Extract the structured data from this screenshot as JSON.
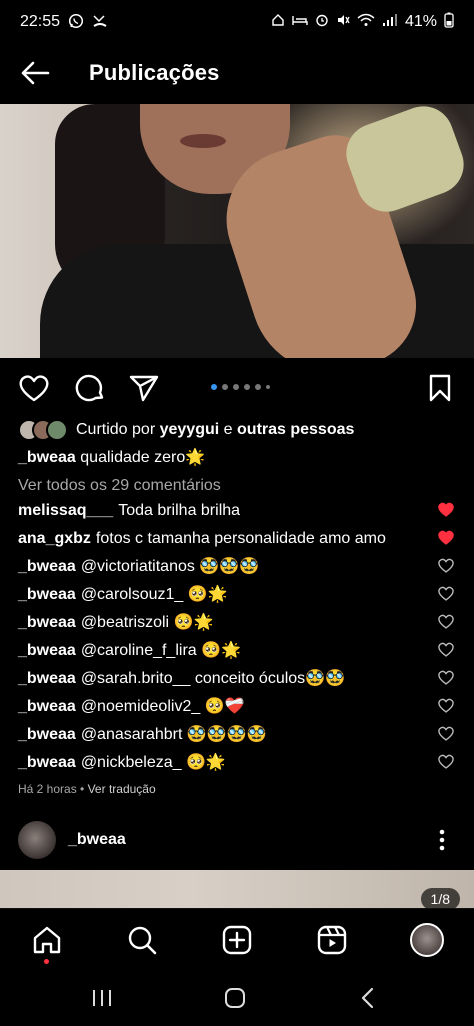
{
  "status_bar": {
    "time": "22:55",
    "left_icons": [
      "whatsapp-icon",
      "missed-call-icon"
    ],
    "right_icons": [
      "home-icon",
      "bed-icon",
      "alarm-icon",
      "mute-icon",
      "wifi-icon",
      "signal-icon"
    ],
    "battery": "41%"
  },
  "header": {
    "title": "Publicações",
    "back_icon": "arrow-left-icon"
  },
  "post": {
    "carousel": {
      "total_dots": 6,
      "active_index": 0
    },
    "likes": {
      "prefix": "Curtido por",
      "user": "yeyygui",
      "connector": "e",
      "others": "outras pessoas"
    },
    "caption": {
      "user": "_bweaa",
      "text": "qualidade zero🌟"
    },
    "view_all_comments": "Ver todos os 29 comentários",
    "comments": [
      {
        "user": "melissaq___",
        "text": "Toda brilha brilha",
        "liked": true
      },
      {
        "user": "ana_gxbz",
        "text": "fotos c tamanha personalidade amo amo",
        "liked": true
      },
      {
        "user": "_bweaa",
        "text": "@victoriatitanos 🥸🥸🥸",
        "liked": false
      },
      {
        "user": "_bweaa",
        "text": "@carolsouz1_ 🥺🌟",
        "liked": false
      },
      {
        "user": "_bweaa",
        "text": "@beatriszoli 🥺🌟",
        "liked": false
      },
      {
        "user": "_bweaa",
        "text": "@caroline_f_lira 🥺🌟",
        "liked": false
      },
      {
        "user": "_bweaa",
        "text": "@sarah.brito__ conceito óculos🥸🥸",
        "liked": false
      },
      {
        "user": "_bweaa",
        "text": "@noemideoliv2_ 🥺❤️‍🩹",
        "liked": false
      },
      {
        "user": "_bweaa",
        "text": "@anasarahbrt 🥸🥸🥸🥸",
        "liked": false
      },
      {
        "user": "_bweaa",
        "text": "@nickbeleza_ 🥺🌟",
        "liked": false
      }
    ],
    "time_ago": "Há 2 horas",
    "separator": "•",
    "translate": "Ver tradução"
  },
  "next_post": {
    "user": "_bweaa",
    "counter": "1/8"
  },
  "colors": {
    "background": "#000000",
    "liked_heart": "#ff3040",
    "carousel_active": "#3797f0",
    "muted_text": "#a8a8a8"
  }
}
